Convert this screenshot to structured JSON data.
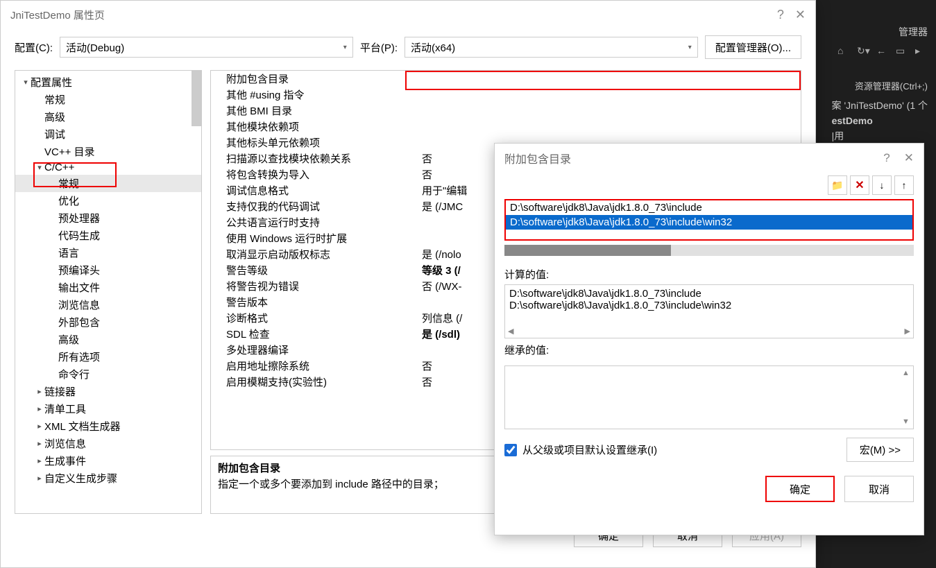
{
  "vs": {
    "tab": "管理器",
    "panel_title": "资源管理器(Ctrl+;)",
    "sol1": "案 'JniTestDemo' (1 个",
    "sol2": "estDemo",
    "sol3": "|用"
  },
  "main": {
    "title": "JniTestDemo 属性页",
    "help": "?",
    "close": "✕",
    "config_label": "配置(C):",
    "config_value": "活动(Debug)",
    "platform_label": "平台(P):",
    "platform_value": "活动(x64)",
    "config_mgr": "配置管理器(O)...",
    "tree": [
      {
        "t": "配置属性",
        "d": 0,
        "a": "▾"
      },
      {
        "t": "常规",
        "d": 1
      },
      {
        "t": "高级",
        "d": 1
      },
      {
        "t": "调试",
        "d": 1
      },
      {
        "t": "VC++ 目录",
        "d": 1
      },
      {
        "t": "C/C++",
        "d": 1,
        "a": "▾"
      },
      {
        "t": "常规",
        "d": 2,
        "sel": true
      },
      {
        "t": "优化",
        "d": 2
      },
      {
        "t": "预处理器",
        "d": 2
      },
      {
        "t": "代码生成",
        "d": 2
      },
      {
        "t": "语言",
        "d": 2
      },
      {
        "t": "预编译头",
        "d": 2
      },
      {
        "t": "输出文件",
        "d": 2
      },
      {
        "t": "浏览信息",
        "d": 2
      },
      {
        "t": "外部包含",
        "d": 2
      },
      {
        "t": "高级",
        "d": 2
      },
      {
        "t": "所有选项",
        "d": 2
      },
      {
        "t": "命令行",
        "d": 2
      },
      {
        "t": "链接器",
        "d": 1,
        "a": "▸"
      },
      {
        "t": "清单工具",
        "d": 1,
        "a": "▸"
      },
      {
        "t": "XML 文档生成器",
        "d": 1,
        "a": "▸"
      },
      {
        "t": "浏览信息",
        "d": 1,
        "a": "▸"
      },
      {
        "t": "生成事件",
        "d": 1,
        "a": "▸"
      },
      {
        "t": "自定义生成步骤",
        "d": 1,
        "a": "▸"
      }
    ],
    "props": [
      {
        "n": "附加包含目录",
        "v": ""
      },
      {
        "n": "其他 #using 指令",
        "v": ""
      },
      {
        "n": "其他 BMI 目录",
        "v": ""
      },
      {
        "n": "其他模块依赖项",
        "v": ""
      },
      {
        "n": "其他标头单元依赖项",
        "v": ""
      },
      {
        "n": "扫描源以查找模块依赖关系",
        "v": "否"
      },
      {
        "n": "将包含转换为导入",
        "v": "否"
      },
      {
        "n": "调试信息格式",
        "v": "用于\"编辑"
      },
      {
        "n": "支持仅我的代码调试",
        "v": "是 (/JMC"
      },
      {
        "n": "公共语言运行时支持",
        "v": ""
      },
      {
        "n": "使用 Windows 运行时扩展",
        "v": ""
      },
      {
        "n": "取消显示启动版权标志",
        "v": "是 (/nolo"
      },
      {
        "n": "警告等级",
        "v": "等级 3 (/",
        "b": true
      },
      {
        "n": "将警告视为错误",
        "v": "否 (/WX-"
      },
      {
        "n": "警告版本",
        "v": ""
      },
      {
        "n": "诊断格式",
        "v": "列信息 (/"
      },
      {
        "n": "SDL 检查",
        "v": "是 (/sdl)",
        "b": true
      },
      {
        "n": "多处理器编译",
        "v": ""
      },
      {
        "n": "启用地址擦除系统",
        "v": "否"
      },
      {
        "n": "启用模糊支持(实验性)",
        "v": "否"
      }
    ],
    "desc_title": "附加包含目录",
    "desc_text": "指定一个或多个要添加到 include 路径中的目录；",
    "ok": "确定",
    "cancel": "取消",
    "apply": "应用(A)"
  },
  "sub": {
    "title": "附加包含目录",
    "help": "?",
    "close": "✕",
    "path1": "D:\\software\\jdk8\\Java\\jdk1.8.0_73\\include",
    "path2": "D:\\software\\jdk8\\Java\\jdk1.8.0_73\\include\\win32",
    "computed_label": "计算的值:",
    "computed1": "D:\\software\\jdk8\\Java\\jdk1.8.0_73\\include",
    "computed2": "D:\\software\\jdk8\\Java\\jdk1.8.0_73\\include\\win32",
    "inherit_label": "继承的值:",
    "checkbox": "从父级或项目默认设置继承(I)",
    "macro": "宏(M) >>",
    "ok": "确定",
    "cancel": "取消"
  }
}
